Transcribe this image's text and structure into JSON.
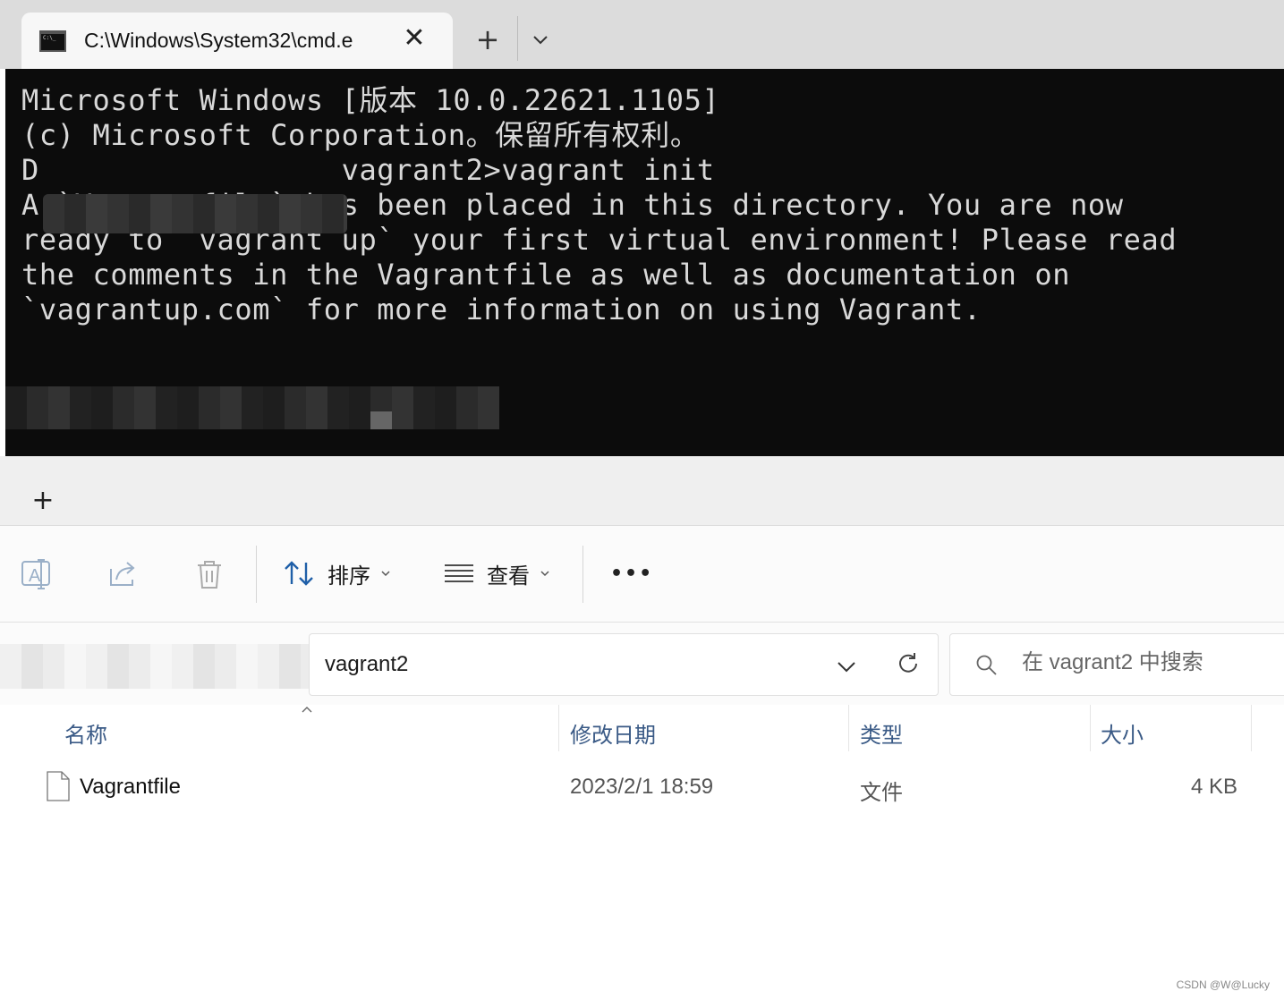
{
  "terminal": {
    "tab_title": "C:\\Windows\\System32\\cmd.e",
    "new_tab": "+",
    "close": "✕",
    "lines": [
      "Microsoft Windows [版本 10.0.22621.1105]",
      "(c) Microsoft Corporation。保留所有权利。",
      "",
      "D                 vagrant2>vagrant init",
      "A `Vagrantfile` has been placed in this directory. You are now",
      "ready to `vagrant up` your first virtual environment! Please read",
      "the comments in the Vagrantfile as well as documentation on",
      "`vagrantup.com` for more information on using Vagrant."
    ]
  },
  "explorer": {
    "new_tab": "+",
    "toolbar": {
      "sort_label": "排序",
      "view_label": "查看",
      "more_label": "•••"
    },
    "address": {
      "current_folder": "vagrant2"
    },
    "search": {
      "placeholder": "在 vagrant2 中搜索"
    },
    "columns": {
      "name": "名称",
      "modified": "修改日期",
      "type": "类型",
      "size": "大小"
    },
    "files": [
      {
        "name": "Vagrantfile",
        "modified": "2023/2/1 18:59",
        "type": "文件",
        "size": "4 KB"
      }
    ]
  },
  "watermark": "CSDN @W@Lucky"
}
